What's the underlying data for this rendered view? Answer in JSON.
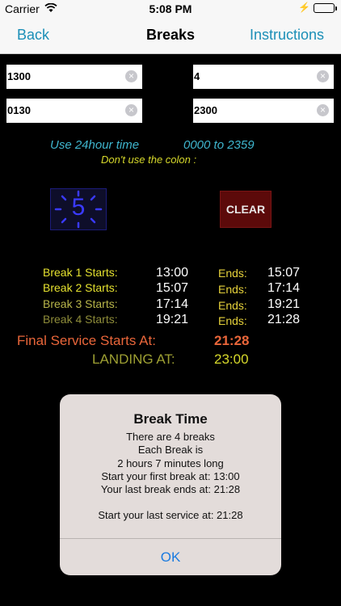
{
  "status": {
    "carrier": "Carrier",
    "time": "5:08 PM"
  },
  "nav": {
    "back": "Back",
    "title": "Breaks",
    "instructions": "Instructions"
  },
  "inputs": {
    "start": "1300",
    "count": "4",
    "duration": "0130",
    "landing": "2300"
  },
  "hint": {
    "line1a": "Use 24hour time",
    "line1b": "0000 to 2359",
    "line2": "Don't use the colon :"
  },
  "counter": {
    "value": "5"
  },
  "clear_button": {
    "label": "CLEAR"
  },
  "breaks": [
    {
      "label": "Break 1 Starts:",
      "start": "13:00",
      "ends_label": "Ends:",
      "end": "15:07"
    },
    {
      "label": "Break 2 Starts:",
      "start": "15:07",
      "ends_label": "Ends:",
      "end": "17:14"
    },
    {
      "label": "Break 3 Starts:",
      "start": "17:14",
      "ends_label": "Ends:",
      "end": "19:21"
    },
    {
      "label": "Break 4 Starts:",
      "start": "19:21",
      "ends_label": "Ends:",
      "end": "21:28"
    }
  ],
  "final": {
    "label": "Final Service Starts At:",
    "value": "21:28"
  },
  "landing": {
    "label": "LANDING AT:",
    "value": "23:00"
  },
  "alert": {
    "title": "Break Time",
    "lines": [
      "There are 4 breaks",
      "Each Break is",
      "2 hours 7 minutes long",
      "Start your first break at: 13:00",
      "Your last break ends at: 21:28",
      "Start your last service at: 21:28"
    ],
    "ok": "OK"
  },
  "colors": {
    "accent": "#1b8fb7",
    "orange": "#e9663a",
    "yellow": "#d6d82b"
  }
}
